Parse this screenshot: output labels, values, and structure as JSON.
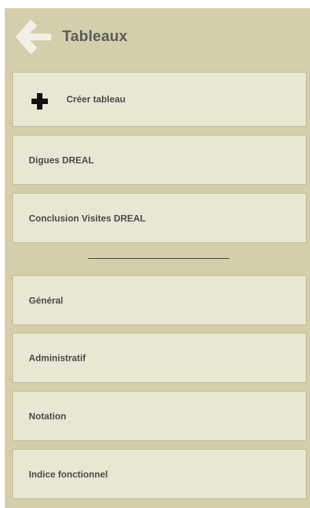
{
  "header": {
    "title": "Tableaux",
    "back_icon": "arrow-left-icon"
  },
  "colors": {
    "panel_background": "#d4cfaa",
    "item_background": "#e8e7d4",
    "item_border": "#bdb995",
    "back_arrow": "#f2f0e6",
    "text": "#4a4a4a"
  },
  "create_item": {
    "label": "Créer tableau",
    "icon": "plus-icon"
  },
  "group_one": [
    {
      "label": "Digues DREAL"
    },
    {
      "label": "Conclusion Visites DREAL"
    }
  ],
  "group_two": [
    {
      "label": "Général"
    },
    {
      "label": "Administratif"
    },
    {
      "label": "Notation"
    },
    {
      "label": "Indice fonctionnel"
    }
  ]
}
